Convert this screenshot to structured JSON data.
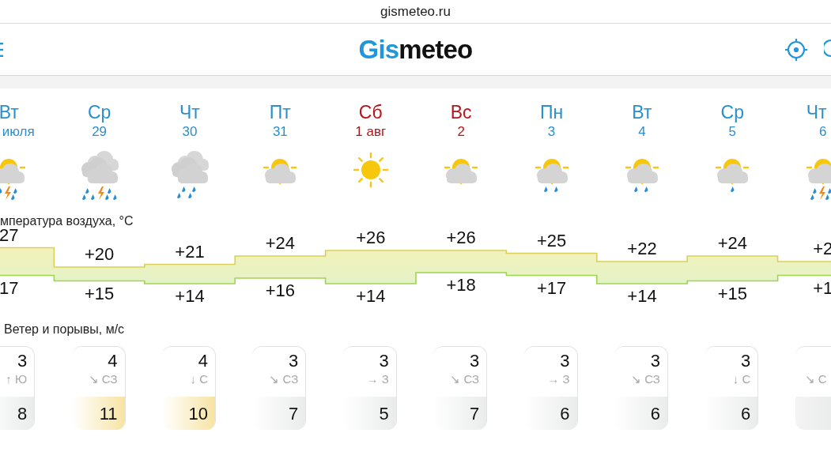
{
  "address_bar": {
    "url": "gismeteo.ru"
  },
  "header": {
    "logo_part_1": "Gis",
    "logo_part_2": "meteo"
  },
  "days": [
    {
      "name": "Вт",
      "date": "июля",
      "weekend": false,
      "kind": "partly_cloudy_storm",
      "max": "27",
      "min": "17",
      "wind": {
        "speed": "3",
        "direction": "↑ Ю",
        "gust": "8",
        "strong": false
      }
    },
    {
      "name": "Ср",
      "date": "29",
      "weekend": false,
      "kind": "cloudy_storm",
      "max": "+20",
      "min": "+15",
      "wind": {
        "speed": "4",
        "direction": "↘ СЗ",
        "gust": "11",
        "strong": true
      }
    },
    {
      "name": "Чт",
      "date": "30",
      "weekend": false,
      "kind": "cloudy_rain",
      "max": "+21",
      "min": "+14",
      "wind": {
        "speed": "4",
        "direction": "↓ С",
        "gust": "10",
        "strong": true
      }
    },
    {
      "name": "Пт",
      "date": "31",
      "weekend": false,
      "kind": "partly_cloudy",
      "max": "+24",
      "min": "+16",
      "wind": {
        "speed": "3",
        "direction": "↘ СЗ",
        "gust": "7",
        "strong": false
      }
    },
    {
      "name": "Сб",
      "date": "1 авг",
      "weekend": true,
      "kind": "sun",
      "max": "+26",
      "min": "+14",
      "wind": {
        "speed": "3",
        "direction": "→ З",
        "gust": "5",
        "strong": false
      }
    },
    {
      "name": "Вс",
      "date": "2",
      "weekend": true,
      "kind": "partly_cloudy",
      "max": "+26",
      "min": "+18",
      "wind": {
        "speed": "3",
        "direction": "↘ СЗ",
        "gust": "7",
        "strong": false
      }
    },
    {
      "name": "Пн",
      "date": "3",
      "weekend": false,
      "kind": "partly_cloudy_rain",
      "max": "+25",
      "min": "+17",
      "wind": {
        "speed": "3",
        "direction": "→ З",
        "gust": "6",
        "strong": false
      }
    },
    {
      "name": "Вт",
      "date": "4",
      "weekend": false,
      "kind": "partly_cloudy_rain",
      "max": "+22",
      "min": "+14",
      "wind": {
        "speed": "3",
        "direction": "↘ СЗ",
        "gust": "6",
        "strong": false
      }
    },
    {
      "name": "Ср",
      "date": "5",
      "weekend": false,
      "kind": "partly_cloudy_drizzle",
      "max": "+24",
      "min": "+15",
      "wind": {
        "speed": "3",
        "direction": "↓ С",
        "gust": "6",
        "strong": false
      }
    },
    {
      "name": "Чт",
      "date": "6",
      "weekend": false,
      "kind": "partly_cloudy_storm",
      "max": "+2",
      "min": "+1",
      "wind": {
        "direction": "↘ С",
        "strong": false
      }
    }
  ],
  "temperature_label": "мпература воздуха, °C",
  "wind_label": "Ветер и порывы, м/с"
}
